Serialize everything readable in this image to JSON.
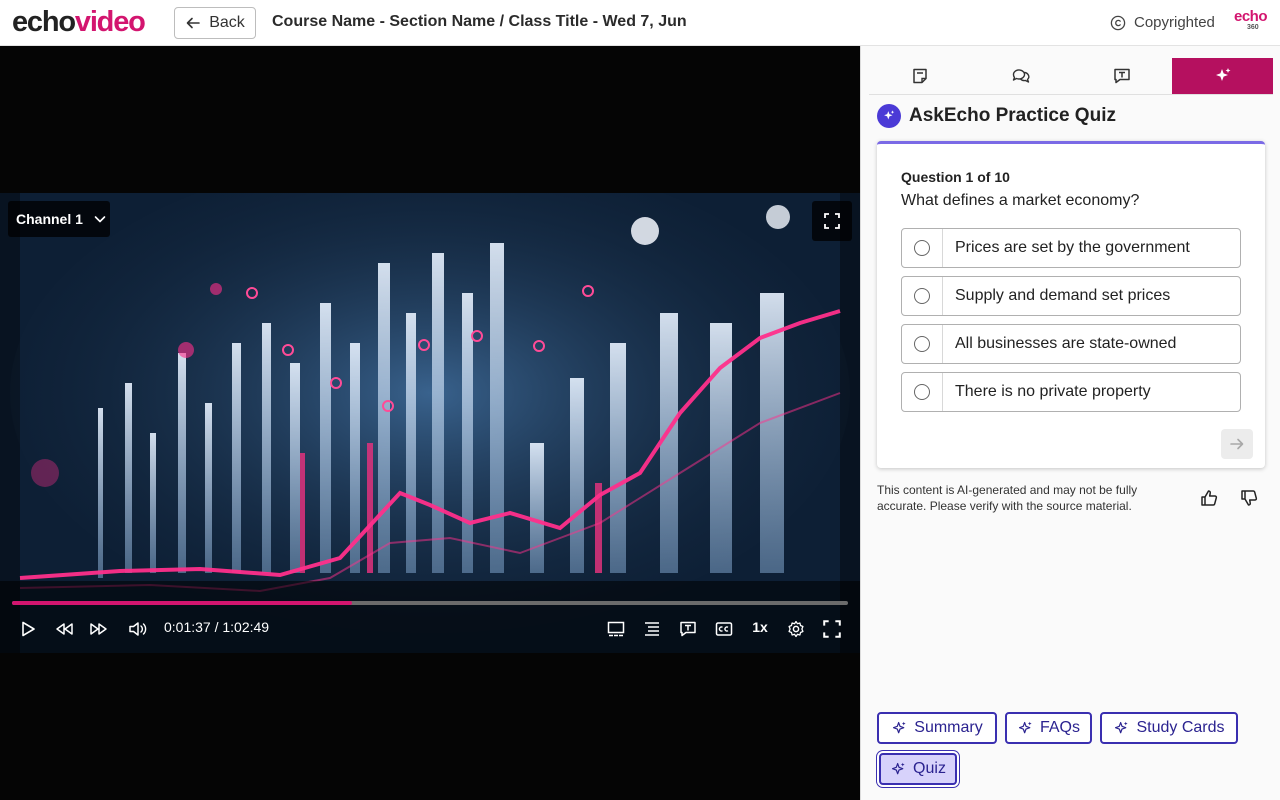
{
  "header": {
    "logo_part1": "echo",
    "logo_part2": "video",
    "back_label": "Back",
    "title": "Course Name - Section Name / Class Title - Wed 7, Jun",
    "copyright_label": "Copyrighted",
    "brand_mini_top": "echo",
    "brand_mini_bottom": "360"
  },
  "player": {
    "channel_label": "Channel 1",
    "time": "0:01:37 / 1:02:49",
    "speed": "1x",
    "progress_fraction": 0.407
  },
  "sidebar": {
    "tabs": [
      {
        "name": "notes",
        "icon": "notes-icon",
        "active": false
      },
      {
        "name": "discussions",
        "icon": "chat-icon",
        "active": false
      },
      {
        "name": "transcript",
        "icon": "transcript-icon",
        "active": false
      },
      {
        "name": "askecho",
        "icon": "sparkle-icon",
        "active": true
      }
    ],
    "heading": "AskEcho Practice Quiz",
    "quiz": {
      "counter": "Question 1 of 10",
      "question": "What defines a market economy?",
      "options": [
        "Prices are set by the government",
        "Supply and demand set prices",
        "All businesses are state-owned",
        "There is no private property"
      ]
    },
    "disclaimer": "This content is AI-generated and may not be fully accurate. Please verify with the source material.",
    "chips": [
      {
        "label": "Summary",
        "active": false
      },
      {
        "label": "FAQs",
        "active": false
      },
      {
        "label": "Study Cards",
        "active": false
      },
      {
        "label": "Quiz",
        "active": true
      }
    ]
  },
  "colors": {
    "brand": "#d3156f",
    "active_tab": "#b5105f",
    "ai_accent": "#3a2fb0",
    "ai_badge": "#4b3ad6"
  }
}
